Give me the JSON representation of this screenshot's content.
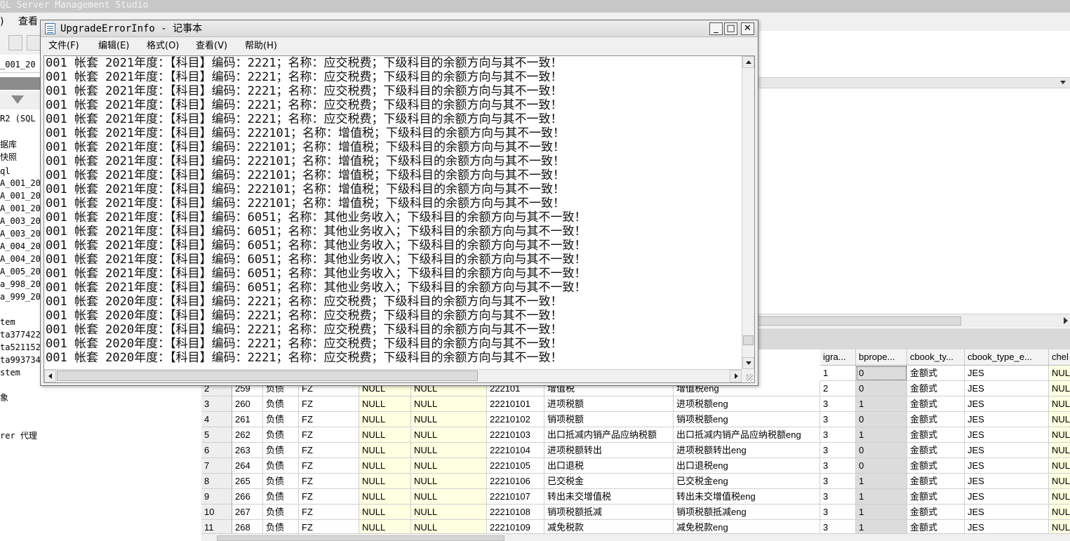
{
  "ssms": {
    "title": "QL Server Management Studio",
    "menu_visible": "查看",
    "db_combo_value": "_001_20",
    "tree_items": [
      "R2 (SQL",
      "据库",
      "快照",
      "ql",
      "A_001_20",
      "A_001_20",
      "A_001_20",
      "A_003_20",
      "A_003_20",
      "A_004_20",
      "A_004_20",
      "A_005_20",
      "a_998_20",
      "a_999_20",
      "",
      "tem",
      "ta377422",
      "ta521152",
      "ta993734",
      "stem",
      "",
      "象",
      "",
      "",
      "rer 代理"
    ]
  },
  "notepad": {
    "title": "UpgradeErrorInfo - 记事本",
    "controls": {
      "minimize": "_",
      "maximize": "□",
      "close": "✕"
    },
    "menu": [
      "文件(F)",
      "编辑(E)",
      "格式(O)",
      "查看(V)",
      "帮助(H)"
    ],
    "lines": [
      "001 帐套 2021年度：【科目】编码：2221；名称：应交税费；下级科目的余额方向与其不一致！",
      "001 帐套 2021年度：【科目】编码：2221；名称：应交税费；下级科目的余额方向与其不一致！",
      "001 帐套 2021年度：【科目】编码：2221；名称：应交税费；下级科目的余额方向与其不一致！",
      "001 帐套 2021年度：【科目】编码：2221；名称：应交税费；下级科目的余额方向与其不一致！",
      "001 帐套 2021年度：【科目】编码：2221；名称：应交税费；下级科目的余额方向与其不一致！",
      "001 帐套 2021年度：【科目】编码：222101；名称：增值税；下级科目的余额方向与其不一致！",
      "001 帐套 2021年度：【科目】编码：222101；名称：增值税；下级科目的余额方向与其不一致！",
      "001 帐套 2021年度：【科目】编码：222101；名称：增值税；下级科目的余额方向与其不一致！",
      "001 帐套 2021年度：【科目】编码：222101；名称：增值税；下级科目的余额方向与其不一致！",
      "001 帐套 2021年度：【科目】编码：222101；名称：增值税；下级科目的余额方向与其不一致！",
      "001 帐套 2021年度：【科目】编码：222101；名称：增值税；下级科目的余额方向与其不一致！",
      "001 帐套 2021年度：【科目】编码：6051；名称：其他业务收入；下级科目的余额方向与其不一致！",
      "001 帐套 2021年度：【科目】编码：6051；名称：其他业务收入；下级科目的余额方向与其不一致！",
      "001 帐套 2021年度：【科目】编码：6051；名称：其他业务收入；下级科目的余额方向与其不一致！",
      "001 帐套 2021年度：【科目】编码：6051；名称：其他业务收入；下级科目的余额方向与其不一致！",
      "001 帐套 2021年度：【科目】编码：6051；名称：其他业务收入；下级科目的余额方向与其不一致！",
      "001 帐套 2021年度：【科目】编码：6051；名称：其他业务收入；下级科目的余额方向与其不一致！",
      "001 帐套 2020年度：【科目】编码：2221；名称：应交税费；下级科目的余额方向与其不一致！",
      "001 帐套 2020年度：【科目】编码：2221；名称：应交税费；下级科目的余额方向与其不一致！",
      "001 帐套 2020年度：【科目】编码：2221；名称：应交税费；下级科目的余额方向与其不一致！",
      "001 帐套 2020年度：【科目】编码：2221；名称：应交税费；下级科目的余额方向与其不一致！",
      "001 帐套 2020年度：【科目】编码：2221；名称：应交税费；下级科目的余额方向与其不一致！"
    ]
  },
  "grid": {
    "headers": [
      "",
      "",
      "",
      "",
      "",
      "",
      "",
      "",
      "",
      "igra...",
      "bprope...",
      "cbook_ty...",
      "cbook_type_e...",
      "chel"
    ],
    "first_row": [
      "",
      "",
      "",
      "",
      "",
      "",
      "",
      "",
      "",
      "1",
      "0",
      "金额式",
      "JES",
      "NUL"
    ],
    "rows": [
      [
        "2",
        "259",
        "负债",
        "FZ",
        "NULL",
        "NULL",
        "222101",
        "增值税",
        "增值税eng",
        "2",
        "0",
        "金额式",
        "JES",
        "NUL"
      ],
      [
        "3",
        "260",
        "负债",
        "FZ",
        "NULL",
        "NULL",
        "22210101",
        "进项税额",
        "进项税额eng",
        "3",
        "1",
        "金额式",
        "JES",
        "NUL"
      ],
      [
        "4",
        "261",
        "负债",
        "FZ",
        "NULL",
        "NULL",
        "22210102",
        "销项税额",
        "销项税额eng",
        "3",
        "0",
        "金额式",
        "JES",
        "NUL"
      ],
      [
        "5",
        "262",
        "负债",
        "FZ",
        "NULL",
        "NULL",
        "22210103",
        "出口抵减内销产品应纳税额",
        "出口抵减内销产品应纳税额eng",
        "3",
        "1",
        "金额式",
        "JES",
        "NUL"
      ],
      [
        "6",
        "263",
        "负债",
        "FZ",
        "NULL",
        "NULL",
        "22210104",
        "进项税额转出",
        "进项税额转出eng",
        "3",
        "0",
        "金额式",
        "JES",
        "NUL"
      ],
      [
        "7",
        "264",
        "负债",
        "FZ",
        "NULL",
        "NULL",
        "22210105",
        "出口退税",
        "出口退税eng",
        "3",
        "0",
        "金额式",
        "JES",
        "NUL"
      ],
      [
        "8",
        "265",
        "负债",
        "FZ",
        "NULL",
        "NULL",
        "22210106",
        "已交税金",
        "已交税金eng",
        "3",
        "1",
        "金额式",
        "JES",
        "NUL"
      ],
      [
        "9",
        "266",
        "负债",
        "FZ",
        "NULL",
        "NULL",
        "22210107",
        "转出未交增值税",
        "转出未交增值税eng",
        "3",
        "1",
        "金额式",
        "JES",
        "NUL"
      ],
      [
        "10",
        "267",
        "负债",
        "FZ",
        "NULL",
        "NULL",
        "22210108",
        "销项税额抵减",
        "销项税额抵减eng",
        "3",
        "1",
        "金额式",
        "JES",
        "NUL"
      ],
      [
        "11",
        "268",
        "负债",
        "FZ",
        "NULL",
        "NULL",
        "22210109",
        "减免税款",
        "减免税款eng",
        "3",
        "1",
        "金额式",
        "JES",
        "NUL"
      ]
    ]
  }
}
